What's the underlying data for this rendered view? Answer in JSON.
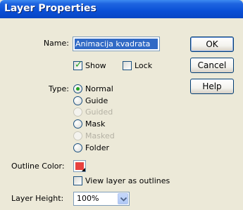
{
  "window": {
    "title": "Layer Properties"
  },
  "name_field": {
    "label": "Name:",
    "value": "Animacija kvadrata"
  },
  "buttons": {
    "ok": "OK",
    "cancel": "Cancel",
    "help": "Help"
  },
  "show": {
    "label": "Show",
    "checked": true
  },
  "lock": {
    "label": "Lock",
    "checked": false
  },
  "type": {
    "label": "Type:",
    "options": [
      {
        "label": "Normal",
        "selected": true,
        "enabled": true
      },
      {
        "label": "Guide",
        "selected": false,
        "enabled": true
      },
      {
        "label": "Guided",
        "selected": false,
        "enabled": false
      },
      {
        "label": "Mask",
        "selected": false,
        "enabled": true
      },
      {
        "label": "Masked",
        "selected": false,
        "enabled": false
      },
      {
        "label": "Folder",
        "selected": false,
        "enabled": true
      }
    ]
  },
  "outline": {
    "label": "Outline Color:",
    "color": "#e8423f",
    "view_as_outlines_label": "View layer as outlines",
    "view_as_outlines_checked": false
  },
  "layer_height": {
    "label": "Layer Height:",
    "value": "100%"
  }
}
